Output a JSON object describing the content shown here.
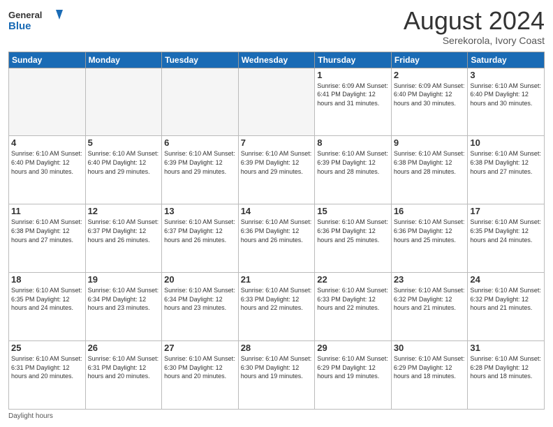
{
  "logo": {
    "text_general": "General",
    "text_blue": "Blue"
  },
  "title": "August 2024",
  "subtitle": "Serekorola, Ivory Coast",
  "days_of_week": [
    "Sunday",
    "Monday",
    "Tuesday",
    "Wednesday",
    "Thursday",
    "Friday",
    "Saturday"
  ],
  "footer_note": "Daylight hours",
  "weeks": [
    [
      {
        "day": "",
        "empty": true
      },
      {
        "day": "",
        "empty": true
      },
      {
        "day": "",
        "empty": true
      },
      {
        "day": "",
        "empty": true
      },
      {
        "day": "1",
        "info": "Sunrise: 6:09 AM\nSunset: 6:41 PM\nDaylight: 12 hours\nand 31 minutes."
      },
      {
        "day": "2",
        "info": "Sunrise: 6:09 AM\nSunset: 6:40 PM\nDaylight: 12 hours\nand 30 minutes."
      },
      {
        "day": "3",
        "info": "Sunrise: 6:10 AM\nSunset: 6:40 PM\nDaylight: 12 hours\nand 30 minutes."
      }
    ],
    [
      {
        "day": "4",
        "info": "Sunrise: 6:10 AM\nSunset: 6:40 PM\nDaylight: 12 hours\nand 30 minutes."
      },
      {
        "day": "5",
        "info": "Sunrise: 6:10 AM\nSunset: 6:40 PM\nDaylight: 12 hours\nand 29 minutes."
      },
      {
        "day": "6",
        "info": "Sunrise: 6:10 AM\nSunset: 6:39 PM\nDaylight: 12 hours\nand 29 minutes."
      },
      {
        "day": "7",
        "info": "Sunrise: 6:10 AM\nSunset: 6:39 PM\nDaylight: 12 hours\nand 29 minutes."
      },
      {
        "day": "8",
        "info": "Sunrise: 6:10 AM\nSunset: 6:39 PM\nDaylight: 12 hours\nand 28 minutes."
      },
      {
        "day": "9",
        "info": "Sunrise: 6:10 AM\nSunset: 6:38 PM\nDaylight: 12 hours\nand 28 minutes."
      },
      {
        "day": "10",
        "info": "Sunrise: 6:10 AM\nSunset: 6:38 PM\nDaylight: 12 hours\nand 27 minutes."
      }
    ],
    [
      {
        "day": "11",
        "info": "Sunrise: 6:10 AM\nSunset: 6:38 PM\nDaylight: 12 hours\nand 27 minutes."
      },
      {
        "day": "12",
        "info": "Sunrise: 6:10 AM\nSunset: 6:37 PM\nDaylight: 12 hours\nand 26 minutes."
      },
      {
        "day": "13",
        "info": "Sunrise: 6:10 AM\nSunset: 6:37 PM\nDaylight: 12 hours\nand 26 minutes."
      },
      {
        "day": "14",
        "info": "Sunrise: 6:10 AM\nSunset: 6:36 PM\nDaylight: 12 hours\nand 26 minutes."
      },
      {
        "day": "15",
        "info": "Sunrise: 6:10 AM\nSunset: 6:36 PM\nDaylight: 12 hours\nand 25 minutes."
      },
      {
        "day": "16",
        "info": "Sunrise: 6:10 AM\nSunset: 6:36 PM\nDaylight: 12 hours\nand 25 minutes."
      },
      {
        "day": "17",
        "info": "Sunrise: 6:10 AM\nSunset: 6:35 PM\nDaylight: 12 hours\nand 24 minutes."
      }
    ],
    [
      {
        "day": "18",
        "info": "Sunrise: 6:10 AM\nSunset: 6:35 PM\nDaylight: 12 hours\nand 24 minutes."
      },
      {
        "day": "19",
        "info": "Sunrise: 6:10 AM\nSunset: 6:34 PM\nDaylight: 12 hours\nand 23 minutes."
      },
      {
        "day": "20",
        "info": "Sunrise: 6:10 AM\nSunset: 6:34 PM\nDaylight: 12 hours\nand 23 minutes."
      },
      {
        "day": "21",
        "info": "Sunrise: 6:10 AM\nSunset: 6:33 PM\nDaylight: 12 hours\nand 22 minutes."
      },
      {
        "day": "22",
        "info": "Sunrise: 6:10 AM\nSunset: 6:33 PM\nDaylight: 12 hours\nand 22 minutes."
      },
      {
        "day": "23",
        "info": "Sunrise: 6:10 AM\nSunset: 6:32 PM\nDaylight: 12 hours\nand 21 minutes."
      },
      {
        "day": "24",
        "info": "Sunrise: 6:10 AM\nSunset: 6:32 PM\nDaylight: 12 hours\nand 21 minutes."
      }
    ],
    [
      {
        "day": "25",
        "info": "Sunrise: 6:10 AM\nSunset: 6:31 PM\nDaylight: 12 hours\nand 20 minutes."
      },
      {
        "day": "26",
        "info": "Sunrise: 6:10 AM\nSunset: 6:31 PM\nDaylight: 12 hours\nand 20 minutes."
      },
      {
        "day": "27",
        "info": "Sunrise: 6:10 AM\nSunset: 6:30 PM\nDaylight: 12 hours\nand 20 minutes."
      },
      {
        "day": "28",
        "info": "Sunrise: 6:10 AM\nSunset: 6:30 PM\nDaylight: 12 hours\nand 19 minutes."
      },
      {
        "day": "29",
        "info": "Sunrise: 6:10 AM\nSunset: 6:29 PM\nDaylight: 12 hours\nand 19 minutes."
      },
      {
        "day": "30",
        "info": "Sunrise: 6:10 AM\nSunset: 6:29 PM\nDaylight: 12 hours\nand 18 minutes."
      },
      {
        "day": "31",
        "info": "Sunrise: 6:10 AM\nSunset: 6:28 PM\nDaylight: 12 hours\nand 18 minutes."
      }
    ]
  ]
}
